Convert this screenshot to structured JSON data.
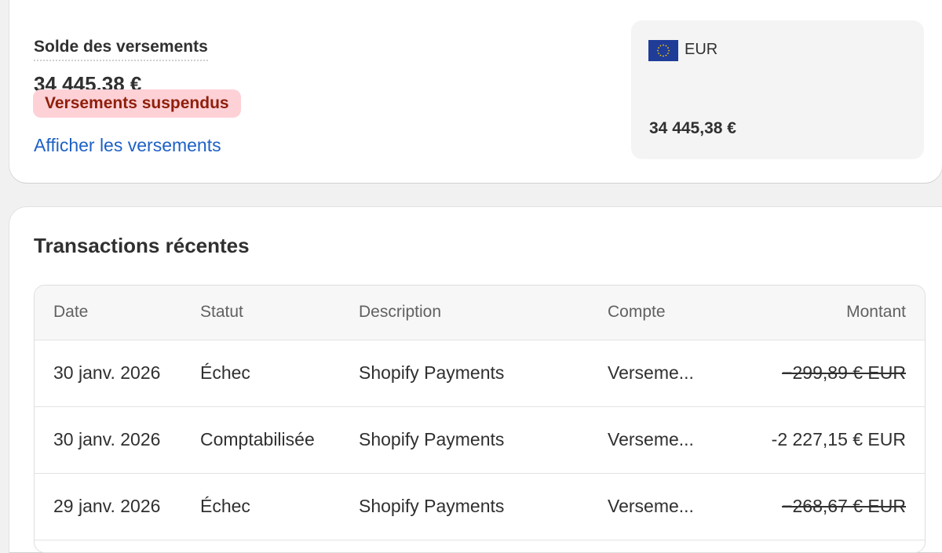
{
  "balance": {
    "label": "Solde des versements",
    "amount": "34 445,38 €",
    "status_badge": "Versements suspendus",
    "view_payouts_link": "Afficher les versements"
  },
  "currency": {
    "flag_icon": "eu-flag-icon",
    "code": "EUR",
    "amount": "34 445,38 €"
  },
  "transactions": {
    "title": "Transactions récentes",
    "columns": [
      "Date",
      "Statut",
      "Description",
      "Compte",
      "Montant"
    ],
    "rows": [
      {
        "date": "30 janv. 2026",
        "status": "Échec",
        "description": "Shopify Payments",
        "account": "Verseme...",
        "amount": "−299,89 € EUR",
        "struck": true
      },
      {
        "date": "30 janv. 2026",
        "status": "Comptabilisée",
        "description": "Shopify Payments",
        "account": "Verseme...",
        "amount": "-2 227,15 € EUR",
        "struck": false
      },
      {
        "date": "29 janv. 2026",
        "status": "Échec",
        "description": "Shopify Payments",
        "account": "Verseme...",
        "amount": "−268,67 € EUR",
        "struck": true
      }
    ]
  },
  "colors": {
    "background": "#f1f1f1",
    "badge_bg": "#fed1d7",
    "badge_text": "#8e1f0b",
    "link": "#1d61c5",
    "flag_blue": "#1f3c98",
    "flag_stars": "#ffcc00"
  }
}
